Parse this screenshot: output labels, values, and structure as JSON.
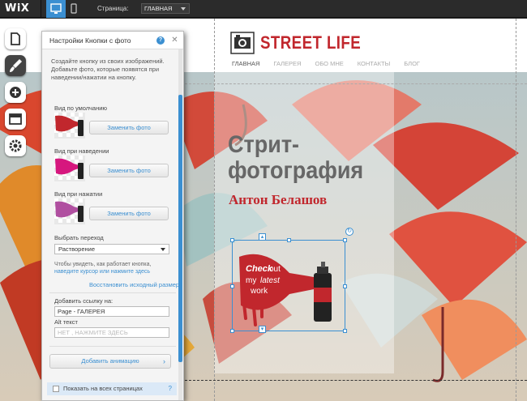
{
  "topbar": {
    "logo": "WiX",
    "pages_label": "Страница:",
    "page_select": "ГЛАВНАЯ"
  },
  "site": {
    "brand": "STREET LIFE",
    "nav": [
      "ГЛАВНАЯ",
      "ГАЛЕРЕЯ",
      "ОБО МНЕ",
      "КОНТАКТЫ",
      "БЛОГ"
    ],
    "hero_title_line1": "Стрит-",
    "hero_title_line2": "фотография",
    "hero_subtitle": "Антон Белашов",
    "button_text": [
      "Check",
      "out",
      "my",
      "latest",
      "work"
    ]
  },
  "panel": {
    "title": "Настройки Кнопки с фото",
    "help": "?",
    "description": "Создайте кнопку из своих изображений. Добавьте фото, которые появятся при наведении/нажатии на кнопку.",
    "states": [
      {
        "label": "Вид по умолчанию",
        "button": "Заменить фото",
        "color": "#c1272d"
      },
      {
        "label": "Вид при наведении",
        "button": "Заменить фото",
        "color": "#d6177e"
      },
      {
        "label": "Вид при нажатии",
        "button": "Заменить фото",
        "color": "#b04fa0"
      }
    ],
    "transition_label": "Выбрать переход",
    "transition_value": "Растворение",
    "hint_text": "Чтобы увидеть, как работает кнопка,",
    "hint_link": "наведите курсор или нажмите здесь",
    "reset_link": "Восстановить исходный размер",
    "link_label": "Добавить ссылку на:",
    "link_value": "Page - ГАЛЕРЕЯ",
    "alt_label": "Alt текст",
    "alt_placeholder": "НЕТ , НАЖМИТЕ ЗДЕСЬ",
    "animation_button": "Добавить анимацию",
    "show_all_label": "Показать на всех страницах",
    "show_all_help": "?"
  },
  "colors": {
    "accent": "#3b8fd1",
    "brand_red": "#c1272d"
  }
}
